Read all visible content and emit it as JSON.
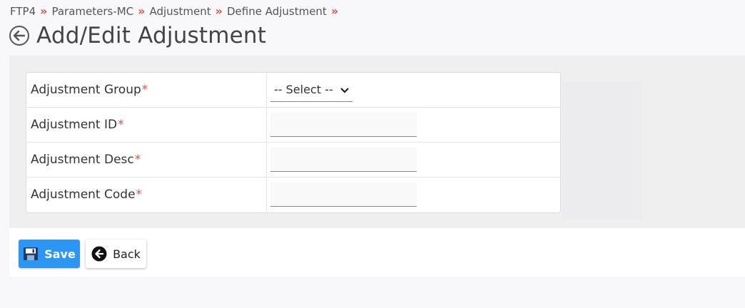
{
  "breadcrumb": [
    {
      "label": "FTP4"
    },
    {
      "label": "Parameters-MC"
    },
    {
      "label": "Adjustment"
    },
    {
      "label": "Define Adjustment"
    }
  ],
  "breadcrumb_separator": "»",
  "page_title": "Add/Edit Adjustment",
  "form": {
    "adjustment_group": {
      "label": "Adjustment Group",
      "required_mark": "*",
      "selected": "-- Select --"
    },
    "adjustment_id": {
      "label": "Adjustment ID",
      "required_mark": "*",
      "value": ""
    },
    "adjustment_desc": {
      "label": "Adjustment Desc",
      "required_mark": "*",
      "value": ""
    },
    "adjustment_code": {
      "label": "Adjustment Code",
      "required_mark": "*",
      "value": ""
    }
  },
  "buttons": {
    "save_label": "Save",
    "back_label": "Back"
  },
  "icons": {
    "title": "circle-arrow-left-icon",
    "save": "floppy-disk-icon",
    "back": "circle-arrow-left-icon",
    "select": "chevron-down-icon"
  },
  "colors": {
    "primary": "#2b96f3",
    "required": "#d9534f",
    "separator": "#d9534f"
  }
}
